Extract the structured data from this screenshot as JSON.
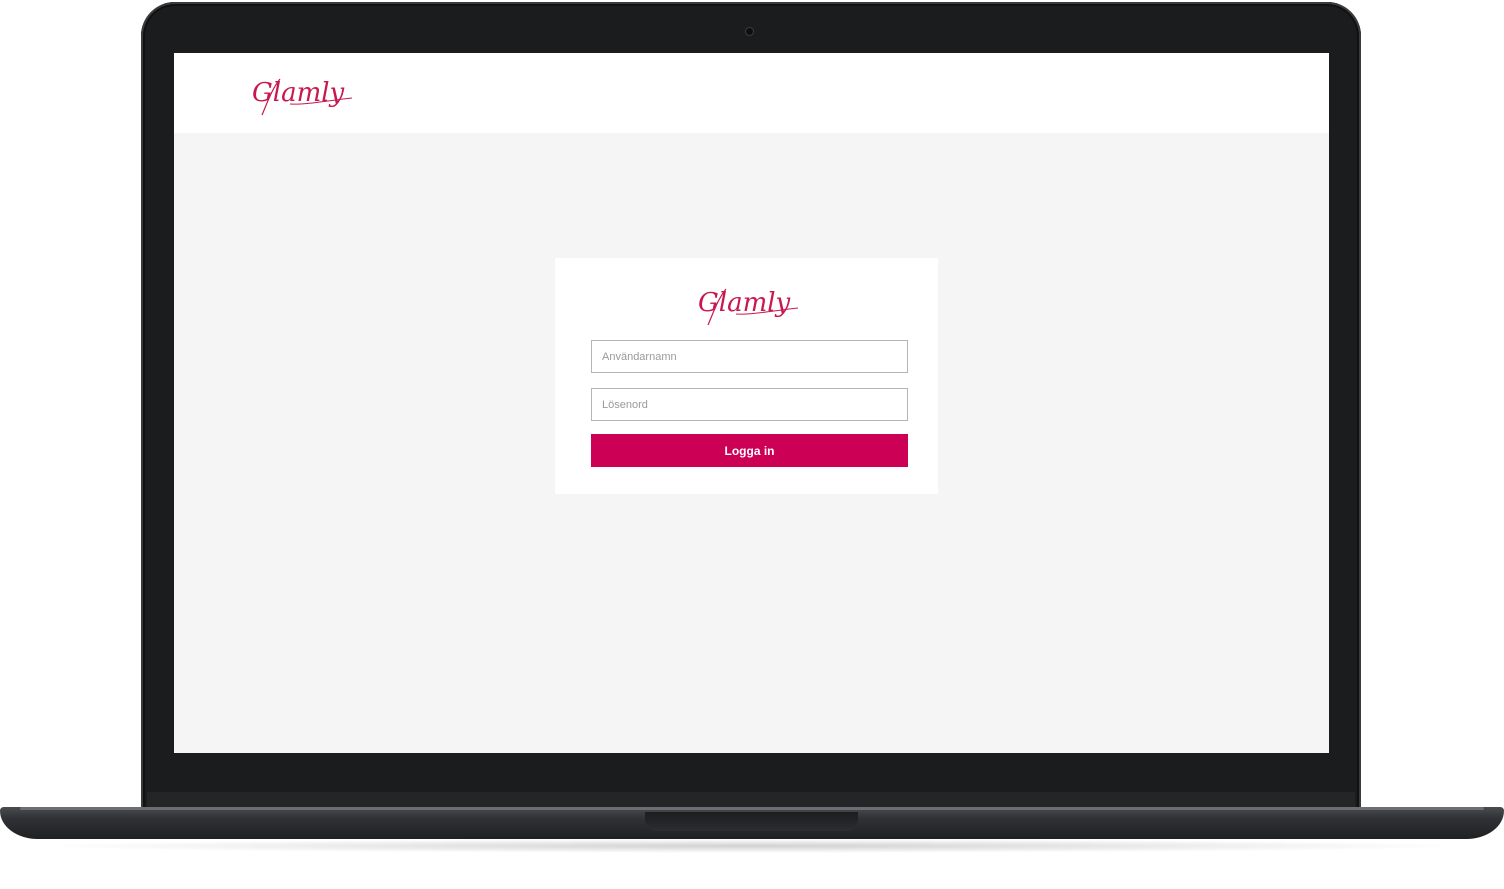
{
  "brand": {
    "logo_text": "Glamly",
    "accent_color": "#cc0055"
  },
  "login": {
    "username_placeholder": "Användarnamn",
    "password_placeholder": "Lösenord",
    "submit_label": "Logga in"
  },
  "device": "laptop"
}
